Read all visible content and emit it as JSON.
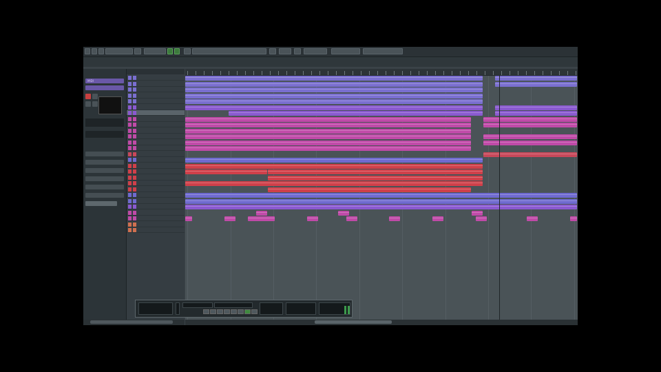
{
  "toolbar": {
    "buttons": [
      "",
      "",
      "",
      "",
      "",
      "",
      "",
      "",
      "",
      "",
      "",
      ""
    ],
    "accent": "#3c7a3c"
  },
  "inspector": {
    "selected_label": "MIDI",
    "meter_label": "",
    "items": [
      "",
      "",
      "",
      "",
      "",
      "",
      "",
      "",
      ""
    ]
  },
  "tracklist": {
    "header": "",
    "tracks": [
      {
        "name": "",
        "color": "#7a6fd0"
      },
      {
        "name": "",
        "color": "#7a6fd0"
      },
      {
        "name": "",
        "color": "#7a6fd0"
      },
      {
        "name": "",
        "color": "#7a6fd0"
      },
      {
        "name": "",
        "color": "#7a6fd0"
      },
      {
        "name": "",
        "color": "#8a5ad0"
      },
      {
        "name": "",
        "color": "#8a5ad0",
        "selected": true
      },
      {
        "name": "",
        "color": "#c04aa8"
      },
      {
        "name": "",
        "color": "#c04aa8"
      },
      {
        "name": "",
        "color": "#c04aa8"
      },
      {
        "name": "",
        "color": "#c04aa8"
      },
      {
        "name": "",
        "color": "#c04aa8"
      },
      {
        "name": "",
        "color": "#c04aa8"
      },
      {
        "name": "",
        "color": "#c8485a"
      },
      {
        "name": "",
        "color": "#6f6ad0"
      },
      {
        "name": "",
        "color": "#d0404a"
      },
      {
        "name": "",
        "color": "#d0404a"
      },
      {
        "name": "",
        "color": "#d0404a"
      },
      {
        "name": "",
        "color": "#d0404a"
      },
      {
        "name": "",
        "color": "#d0404a"
      },
      {
        "name": "",
        "color": "#6f6ad0"
      },
      {
        "name": "",
        "color": "#6f6ad0"
      },
      {
        "name": "",
        "color": "#8a5ad0"
      },
      {
        "name": "",
        "color": "#c04aa8"
      },
      {
        "name": "",
        "color": "#c04aa8"
      },
      {
        "name": "",
        "color": "#d07050"
      },
      {
        "name": "",
        "color": "#d07050"
      }
    ]
  },
  "transport": {
    "position_left": "",
    "position_right": "",
    "tempo": "",
    "signature": ""
  }
}
